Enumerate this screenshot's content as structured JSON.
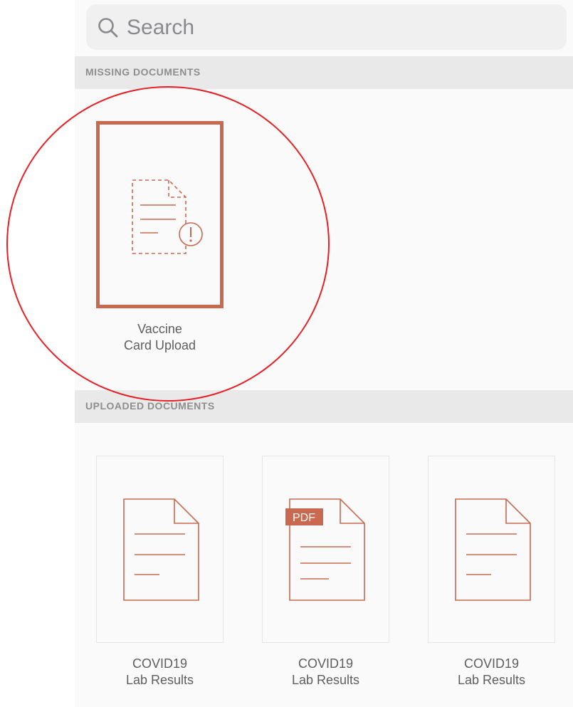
{
  "search": {
    "placeholder": "Search",
    "icon": "search-icon"
  },
  "sections": {
    "missing": {
      "title": "MISSING DOCUMENTS",
      "items": [
        {
          "line1": "Vaccine",
          "line2": "Card Upload",
          "icon": "missing-document-icon"
        }
      ]
    },
    "uploaded": {
      "title": "UPLOADED DOCUMENTS",
      "items": [
        {
          "line1": "COVID19",
          "line2": "Lab Results",
          "icon": "document-icon"
        },
        {
          "line1": "COVID19",
          "line2": "Lab Results",
          "icon": "pdf-document-icon",
          "badge": "PDF"
        },
        {
          "line1": "COVID19",
          "line2": "Lab Results",
          "icon": "document-icon"
        }
      ]
    }
  },
  "colors": {
    "accent": "#c9694f",
    "annotation": "#e81f24",
    "section_header_bg": "#e9e9ea",
    "section_header_text": "#8e8e8e"
  }
}
